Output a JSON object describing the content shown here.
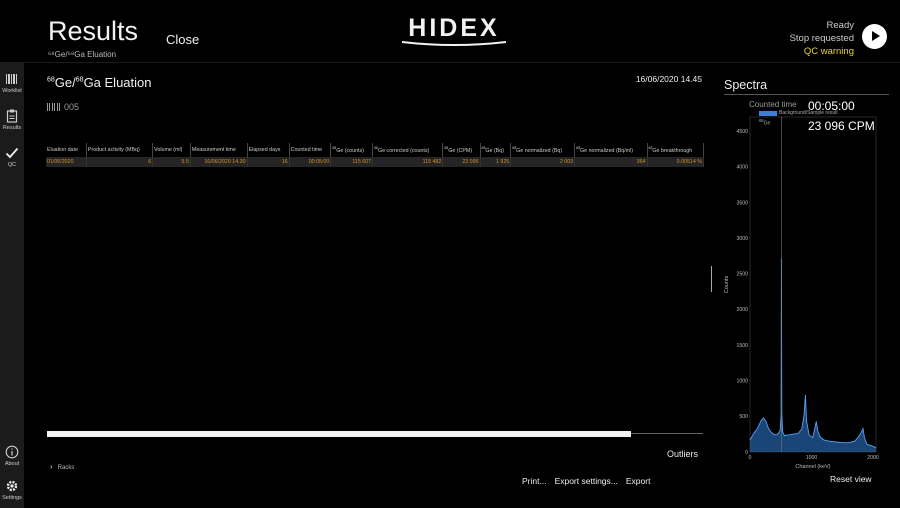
{
  "window": {
    "minimize_glyph": "–",
    "restore_glyph": "❐"
  },
  "header": {
    "title": "Results",
    "subtitle": "⁶⁸Ge/⁶⁸Ga Eluation",
    "close_label": "Close",
    "logo_text": "HIDEX",
    "status_ready": "Ready",
    "status_stop": "Stop requested",
    "status_qc": "QC warning",
    "status_qc_color": "#e7d637"
  },
  "sidebar": {
    "items": [
      {
        "label": "Worklist",
        "icon": "barcode-icon"
      },
      {
        "label": "Results",
        "icon": "clipboard-icon"
      },
      {
        "label": "QC",
        "icon": "checkmark-icon"
      },
      {
        "label": "About",
        "icon": "info-icon"
      },
      {
        "label": "Settings",
        "icon": "gear-icon"
      }
    ]
  },
  "content": {
    "title_prefix_sup": "68",
    "title_ge": "Ge/",
    "title_ga_sup": "68",
    "title_ga": "Ga Eluation",
    "date": "16/06/2020 14.45",
    "barcode_text": "005",
    "table": {
      "columns": [
        {
          "sup": "",
          "text": "Eluation date"
        },
        {
          "sup": "",
          "text": "Product activity (MBq)"
        },
        {
          "sup": "",
          "text": "Volume (ml)"
        },
        {
          "sup": "",
          "text": "Measurement time"
        },
        {
          "sup": "",
          "text": "Elapsed days"
        },
        {
          "sup": "",
          "text": "Counted time"
        },
        {
          "sup": "68",
          "text": "Ge (counts)"
        },
        {
          "sup": "68",
          "text": "Ge corrected (counts)"
        },
        {
          "sup": "68",
          "text": "Ge (CPM)"
        },
        {
          "sup": "68",
          "text": "Ge  (Bq)"
        },
        {
          "sup": "68",
          "text": "Ge normalized (Bq)"
        },
        {
          "sup": "68",
          "text": "Ge normalized (Bq/ml)"
        },
        {
          "sup": "68",
          "text": "Ge breakthrough"
        }
      ],
      "rows": [
        [
          "01/06/2020",
          "6",
          "5.5",
          "16/06/2020 14.30",
          "16",
          "00:05:00",
          "115 607",
          "115 482",
          "23 096",
          "1 925",
          "2 003",
          "364",
          "0.00514 %"
        ]
      ]
    },
    "progress_fraction": 0.89,
    "outliers_label": "Outliers",
    "racks_label": "Racks",
    "footer": {
      "print": "Print...",
      "export_settings": "Export settings...",
      "export": "Export"
    }
  },
  "spectra": {
    "title": "Spectra",
    "counted_time_label": "Counted time",
    "counted_time_value": "00:05:00",
    "legend_label": "Background/Sample result",
    "ge_sup": "68",
    "ge_label": "Ge",
    "ge_cpm": "23 096 CPM",
    "reset_view_label": "Reset view",
    "series_color": "#2f7ed8"
  },
  "chart_data": {
    "type": "area",
    "xlabel": "Channel (keV)",
    "ylabel": "Counts",
    "xlim": [
      0,
      2048
    ],
    "ylim": [
      0,
      4700
    ],
    "xticks": [
      0,
      1000,
      2000
    ],
    "yticks": [
      0,
      500,
      1000,
      1500,
      2000,
      2500,
      3000,
      3500,
      4000,
      4500
    ],
    "marker_x": 511,
    "x": [
      0,
      60,
      120,
      180,
      220,
      260,
      300,
      340,
      380,
      420,
      460,
      490,
      505,
      511,
      517,
      530,
      560,
      620,
      700,
      780,
      840,
      880,
      900,
      920,
      960,
      1020,
      1077,
      1100,
      1140,
      1200,
      1300,
      1400,
      1500,
      1600,
      1700,
      1760,
      1800,
      1836,
      1860,
      1900,
      2000,
      2048
    ],
    "series": [
      {
        "values": [
          170,
          260,
          330,
          440,
          480,
          430,
          330,
          280,
          250,
          240,
          260,
          300,
          520,
          2720,
          560,
          280,
          230,
          240,
          250,
          260,
          320,
          520,
          800,
          430,
          240,
          200,
          430,
          300,
          210,
          170,
          150,
          140,
          130,
          130,
          150,
          210,
          260,
          330,
          200,
          110,
          80,
          60
        ]
      }
    ]
  }
}
